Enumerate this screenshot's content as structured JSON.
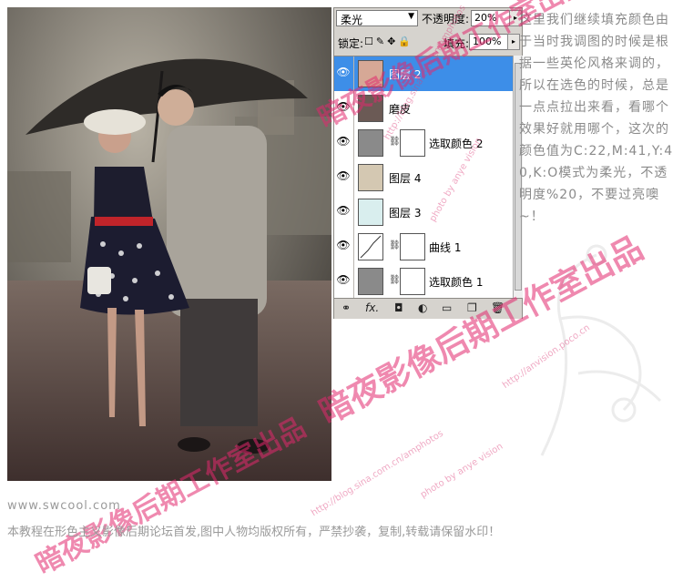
{
  "panel": {
    "blend_mode": "柔光",
    "opacity_label": "不透明度:",
    "opacity_value": "20%",
    "lock_label": "锁定:",
    "fill_label": "填充:",
    "fill_value": "100%",
    "layers": [
      {
        "name": "图层 2",
        "selected": true,
        "thumb_color": "#d6a896"
      },
      {
        "name": "磨皮",
        "selected": false,
        "thumb_color": "#6b5a55"
      },
      {
        "name": "选取颜色 2",
        "selected": false,
        "thumb_color": "#8a8a8a"
      },
      {
        "name": "图层 4",
        "selected": false,
        "thumb_color": "#d4c8b2"
      },
      {
        "name": "图层 3",
        "selected": false,
        "thumb_color": "#d9eeee"
      },
      {
        "name": "曲线 1",
        "selected": false,
        "thumb_color": "#ffffff"
      },
      {
        "name": "选取颜色 1",
        "selected": false,
        "thumb_color": "#8a8a8a"
      }
    ],
    "bottom_icons": [
      "link-icon",
      "fx-icon",
      "mask-icon",
      "adjustment-icon",
      "folder-icon",
      "new-layer-icon",
      "trash-icon"
    ],
    "fx_label": "fx."
  },
  "tutorial_text": "这里我们继续填充颜色由于当时我调图的时候是根据一些英伦风格来调的，所以在选色的时候，总是一点点拉出来看，看哪个效果好就用哪个，这次的颜色值为C:22,M:41,Y:40,K:O模式为柔光，不透明度%20，不要过亮噢~！",
  "site": "www.swcool.com",
  "notice": "本教程在形色主义影像后期论坛首发,图中人物均版权所有，严禁抄袭，复制,转载请保留水印！",
  "watermark": {
    "main": "暗夜影像后期工作室出品",
    "url1": "http://blog.sina.com.cn/amphotos",
    "url2": "http://anvision.poco.cn",
    "small": "photo by anye vision"
  },
  "colors": {
    "accent": "#3d8ee8",
    "watermark": "#e1286e",
    "text_gray": "#8a8a8a"
  }
}
